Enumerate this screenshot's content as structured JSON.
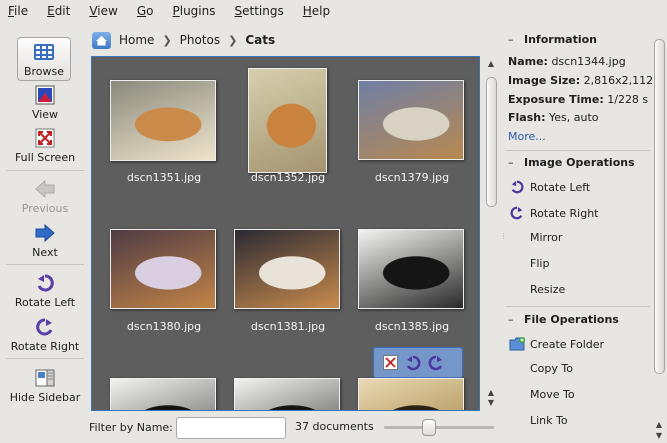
{
  "menubar": [
    {
      "m": "F",
      "rest": "ile"
    },
    {
      "m": "E",
      "rest": "dit"
    },
    {
      "m": "V",
      "rest": "iew"
    },
    {
      "m": "G",
      "rest": "o"
    },
    {
      "m": "P",
      "rest": "lugins"
    },
    {
      "m": "S",
      "rest": "ettings"
    },
    {
      "m": "H",
      "rest": "elp"
    }
  ],
  "toolbar": {
    "browse": "Browse",
    "view": "View",
    "full_screen": "Full Screen",
    "previous": "Previous",
    "next": "Next",
    "rotate_left": "Rotate Left",
    "rotate_right": "Rotate Right",
    "hide_sidebar": "Hide Sidebar"
  },
  "breadcrumb": {
    "items": [
      "Home",
      "Photos",
      "Cats"
    ]
  },
  "thumbnails": [
    {
      "caption": "dscn1351.jpg",
      "palette": [
        "#8b8a7d",
        "#c98a4a",
        "#efe4cc"
      ]
    },
    {
      "caption": "dscn1352.jpg",
      "palette": [
        "#d6cfae",
        "#c9833f",
        "#a59470"
      ]
    },
    {
      "caption": "dscn1379.jpg",
      "palette": [
        "#6f7fa4",
        "#d8d2c4",
        "#b98950"
      ]
    },
    {
      "caption": "dscn1380.jpg",
      "palette": [
        "#4f3b45",
        "#d9cfe0",
        "#c28446"
      ]
    },
    {
      "caption": "dscn1381.jpg",
      "palette": [
        "#2b2a33",
        "#e8e2d8",
        "#c98b4d"
      ]
    },
    {
      "caption": "dscn1385.jpg",
      "palette": [
        "#f4f4f2",
        "#151515",
        "#2a2a2a"
      ]
    },
    {
      "caption": "",
      "palette": [
        "#f2f2f0",
        "#111111",
        "#555555"
      ]
    },
    {
      "caption": "",
      "palette": [
        "#f2f2f0",
        "#151515",
        "#444444"
      ]
    },
    {
      "caption": "",
      "palette": [
        "#e9d9b4",
        "#2a2418",
        "#a08040"
      ]
    }
  ],
  "bottombar": {
    "filter_label": "Filter by Name:",
    "filter_value": "",
    "doc_count": "37 documents",
    "zoom_level": 0.4
  },
  "sidebar": {
    "information": {
      "title": "Information",
      "name_label": "Name:",
      "name_value": "dscn1344.jpg",
      "size_label": "Image Size:",
      "size_value": "2,816x2,112",
      "exposure_label": "Exposure Time:",
      "exposure_value": "1/228 s",
      "flash_label": "Flash:",
      "flash_value": "Yes, auto",
      "more": "More..."
    },
    "image_ops": {
      "title": "Image Operations",
      "rotate_left": "Rotate Left",
      "rotate_right": "Rotate Right",
      "mirror": "Mirror",
      "flip": "Flip",
      "resize": "Resize"
    },
    "file_ops": {
      "title": "File Operations",
      "create_folder": "Create Folder",
      "copy_to": "Copy To",
      "move_to": "Move To",
      "link_to": "Link To"
    }
  },
  "colors": {
    "accent": "#3d73b8",
    "thumb_bg": "#5e5e5e",
    "link": "#2a5db0"
  }
}
